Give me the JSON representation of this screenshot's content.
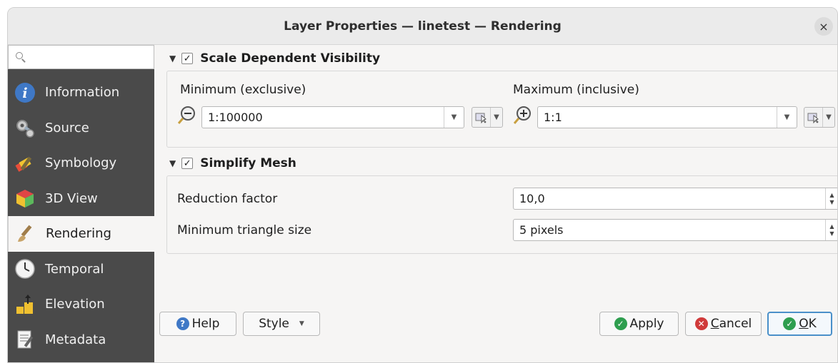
{
  "window": {
    "title": "Layer Properties — linetest — Rendering",
    "close_glyph": "×"
  },
  "sidebar": {
    "search": {
      "placeholder": "",
      "value": ""
    },
    "items": [
      {
        "label": "Information",
        "icon": "info-icon",
        "active": false
      },
      {
        "label": "Source",
        "icon": "source-icon",
        "active": false
      },
      {
        "label": "Symbology",
        "icon": "symbology-icon",
        "active": false
      },
      {
        "label": "3D View",
        "icon": "3d-view-icon",
        "active": false
      },
      {
        "label": "Rendering",
        "icon": "rendering-brush-icon",
        "active": true
      },
      {
        "label": "Temporal",
        "icon": "clock-icon",
        "active": false
      },
      {
        "label": "Elevation",
        "icon": "elevation-icon",
        "active": false
      },
      {
        "label": "Metadata",
        "icon": "metadata-icon",
        "active": false
      }
    ]
  },
  "scale_visibility": {
    "title": "Scale Dependent Visibility",
    "checked": true,
    "min_label": "Minimum (exclusive)",
    "min_value": "1:100000",
    "max_label": "Maximum (inclusive)",
    "max_value": "1:1"
  },
  "simplify_mesh": {
    "title": "Simplify Mesh",
    "checked": true,
    "reduction_label": "Reduction factor",
    "reduction_value": "10,0",
    "min_triangle_label": "Minimum triangle size",
    "min_triangle_value": "5 pixels"
  },
  "buttons": {
    "help": "Help",
    "style": "Style",
    "apply": "Apply",
    "cancel_prefix": "C",
    "cancel_rest": "ancel",
    "ok_prefix": "O",
    "ok_rest": "K"
  },
  "colors": {
    "sidebar_bg": "#4a4a4a",
    "accent": "#4a90c9",
    "apply_green": "#2e9e4f",
    "cancel_red": "#d03a3a"
  }
}
